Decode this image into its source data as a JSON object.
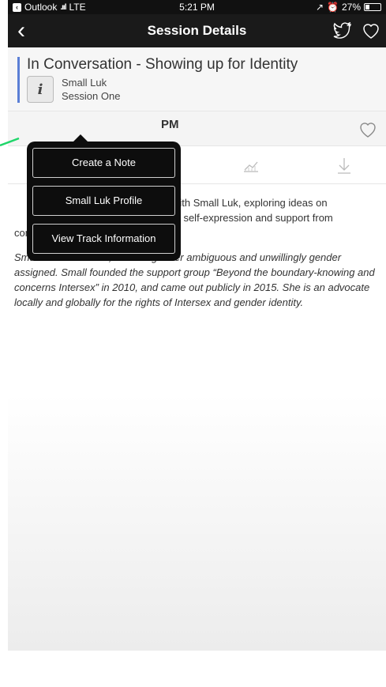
{
  "status_bar": {
    "back_app": "Outlook",
    "carrier": "LTE",
    "time": "5:21 PM",
    "battery": "27%",
    "battery_level": 0.27
  },
  "nav": {
    "back_icon": "chevron-left-icon",
    "title": "Session Details",
    "actions": [
      "twitter-bird-icon",
      "heart-outline-icon"
    ]
  },
  "session": {
    "title": "In Conversation - Showing up for Identity",
    "info_label": "i",
    "speaker": "Small Luk",
    "track": "Session One",
    "time": "PM",
    "accent_color": "#5b7fd6"
  },
  "popover": {
    "items": [
      {
        "label": "Create a Note"
      },
      {
        "label": "Small Luk Profile"
      },
      {
        "label": "View Track Information"
      }
    ]
  },
  "content": {
    "description_visible_1": "with Small Luk, exploring ideas on",
    "description_visible_2": "of self-expression and support from",
    "description_visible_3": "community in forming identity.",
    "bio": "Small Luk is Intersex, born as gender ambiguous and unwillingly gender assigned. Small founded the support group “Beyond the boundary-knowing and concerns Intersex” in 2010, and came out publicly in 2015. She is an advocate locally and globally for the rights of Intersex and gender identity."
  }
}
